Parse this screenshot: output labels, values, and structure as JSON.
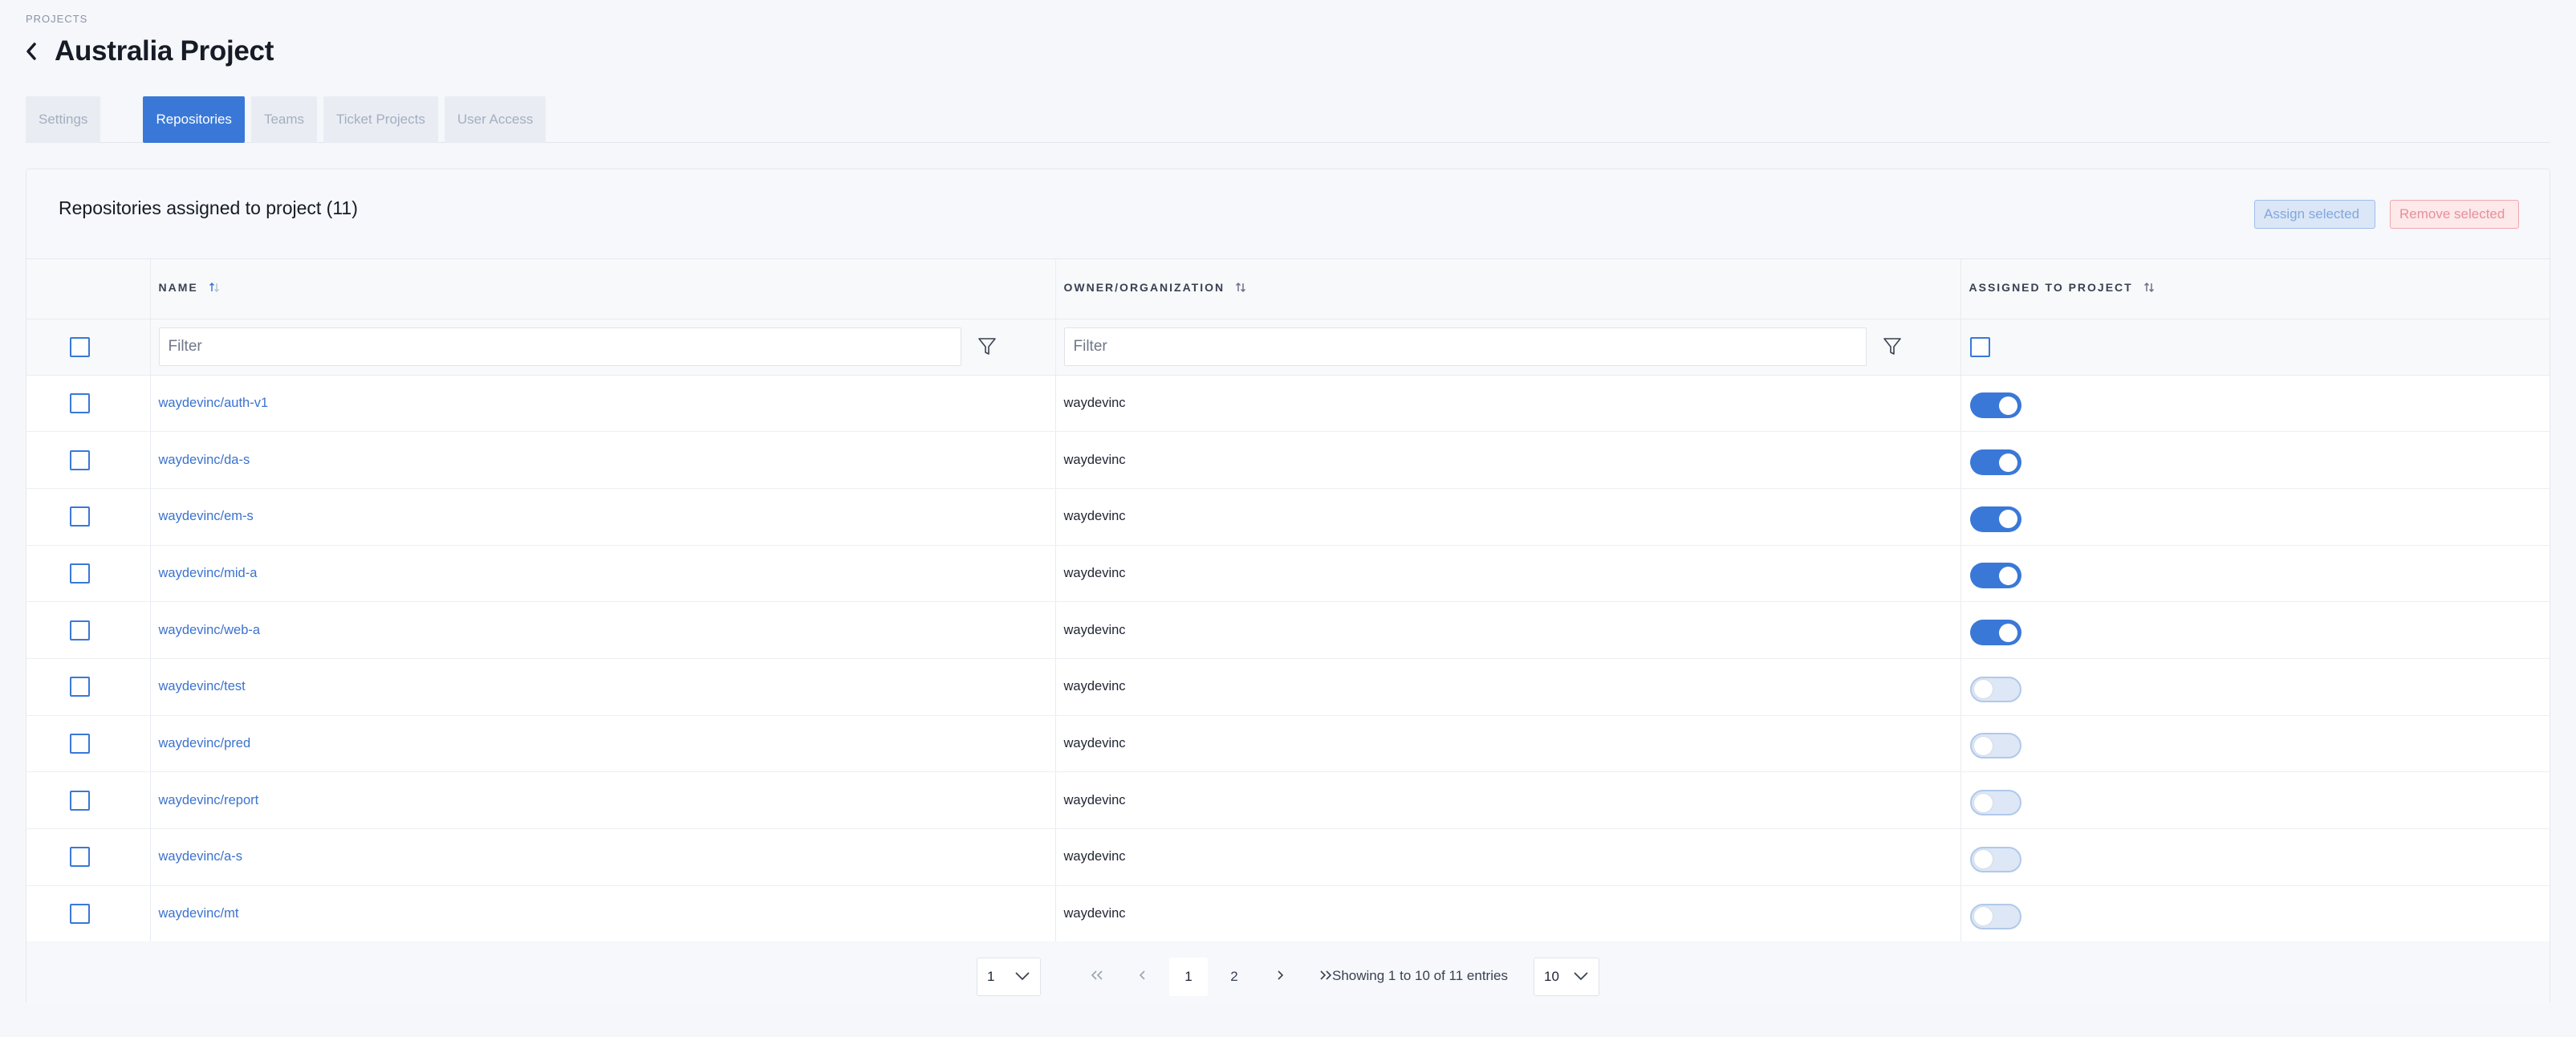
{
  "breadcrumb": "PROJECTS",
  "page_title": "Australia Project",
  "tabs": [
    {
      "label": "Settings",
      "active": false
    },
    {
      "label": "Repositories",
      "active": true
    },
    {
      "label": "Teams",
      "active": false
    },
    {
      "label": "Ticket Projects",
      "active": false
    },
    {
      "label": "User Access",
      "active": false
    }
  ],
  "panel": {
    "title": "Repositories assigned to project (11)",
    "assign_label": "Assign selected",
    "remove_label": "Remove selected"
  },
  "columns": {
    "name": "NAME",
    "owner": "OWNER/ORGANIZATION",
    "assigned": "ASSIGNED TO PROJECT"
  },
  "filters": {
    "name_placeholder": "Filter",
    "owner_placeholder": "Filter"
  },
  "rows": [
    {
      "name": "waydevinc/auth-v1",
      "owner": "waydevinc",
      "assigned": true
    },
    {
      "name": "waydevinc/da-s",
      "owner": "waydevinc",
      "assigned": true
    },
    {
      "name": "waydevinc/em-s",
      "owner": "waydevinc",
      "assigned": true
    },
    {
      "name": "waydevinc/mid-a",
      "owner": "waydevinc",
      "assigned": true
    },
    {
      "name": "waydevinc/web-a",
      "owner": "waydevinc",
      "assigned": true
    },
    {
      "name": "waydevinc/test",
      "owner": "waydevinc",
      "assigned": false
    },
    {
      "name": "waydevinc/pred",
      "owner": "waydevinc",
      "assigned": false
    },
    {
      "name": "waydevinc/report",
      "owner": "waydevinc",
      "assigned": false
    },
    {
      "name": "waydevinc/a-s",
      "owner": "waydevinc",
      "assigned": false
    },
    {
      "name": "waydevinc/mt",
      "owner": "waydevinc",
      "assigned": false
    }
  ],
  "pagination": {
    "page_select_value": "1",
    "pages": [
      "1",
      "2"
    ],
    "current_page": "1",
    "entries_text": "Showing 1 to 10 of 11 entries",
    "page_size_value": "10"
  },
  "colors": {
    "accent": "#3a78d8",
    "link": "#3a72cf",
    "danger_border": "#f0a7ae"
  },
  "icons": {
    "back": "chevron-left-icon",
    "sort": "sort-icon",
    "filter": "funnel-icon",
    "first": "double-chevron-left-icon",
    "prev": "chevron-left-icon",
    "next": "chevron-right-icon",
    "last": "double-chevron-right-icon",
    "dropdown": "chevron-down-icon"
  }
}
